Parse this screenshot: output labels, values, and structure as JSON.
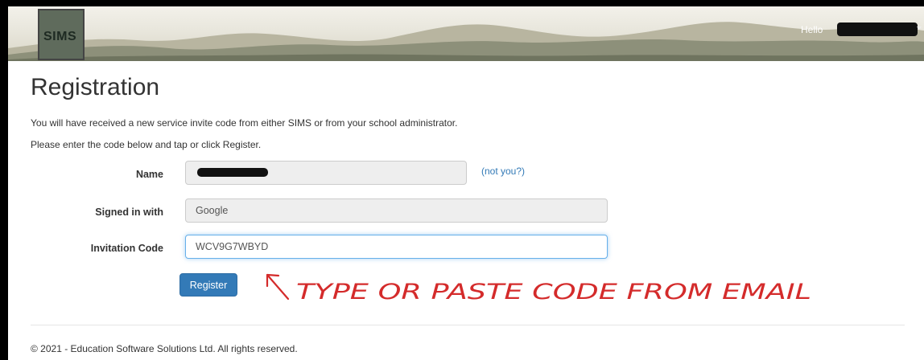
{
  "header": {
    "logo": "SIMS",
    "greeting": "Hello",
    "user_menu_caret": "caret-down-icon"
  },
  "page": {
    "title": "Registration",
    "intro_line1": "You will have received a new service invite code from either SIMS or from your school administrator.",
    "intro_line2": "Please enter the code below and tap or click Register."
  },
  "form": {
    "name_label": "Name",
    "name_value": "",
    "not_you_link": "(not you?)",
    "signed_in_label": "Signed in with",
    "signed_in_value": "Google",
    "invitation_label": "Invitation Code",
    "invitation_value": "WCV9G7WBYD",
    "register_button": "Register"
  },
  "annotation": {
    "text": "TYPE OR PASTE CODE FROM EMAIL",
    "color": "#d42b2b"
  },
  "footer": {
    "copyright": "© 2021 - Education Software Solutions Ltd. All rights reserved."
  },
  "colors": {
    "primary": "#337ab7",
    "link": "#337ab7",
    "redaction": "#111111"
  }
}
